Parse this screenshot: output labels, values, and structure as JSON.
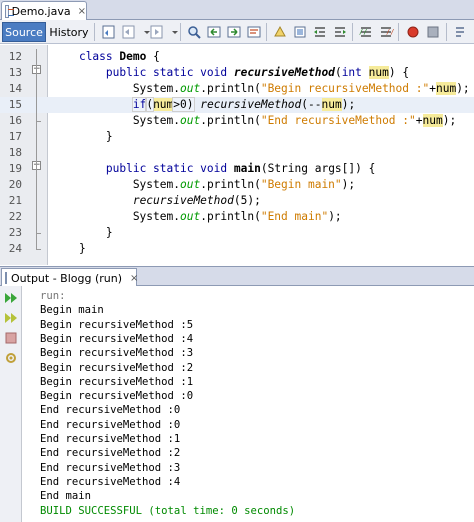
{
  "editor_tab": {
    "filename": "Demo.java",
    "close_glyph": "×"
  },
  "toolbar": {
    "source_label": "Source",
    "history_label": "History",
    "icons": [
      "last-edit-icon",
      "back-icon",
      "forward-icon",
      "find-icon",
      "find-previous-icon",
      "find-next-icon",
      "find-selection-icon",
      "toggle-highlight-icon",
      "toggle-rectangular-icon",
      "shift-left-icon",
      "shift-right-icon",
      "comment-icon",
      "uncomment-icon",
      "start-macro-icon",
      "stop-macro-icon"
    ]
  },
  "code_lines": [
    {
      "num": "12",
      "tokens": [
        [
          "",
          "    "
        ],
        [
          "kw",
          "class"
        ],
        [
          "",
          " "
        ],
        [
          "bold",
          "Demo"
        ],
        [
          "",
          " {"
        ]
      ]
    },
    {
      "num": "13",
      "tokens": [
        [
          "",
          "        "
        ],
        [
          "kw",
          "public static void"
        ],
        [
          "",
          " "
        ],
        [
          "mth bold",
          "recursiveMethod"
        ],
        [
          "",
          "("
        ],
        [
          "kw",
          "int"
        ],
        [
          "",
          " "
        ],
        [
          "var",
          "num"
        ],
        [
          "",
          ") {"
        ]
      ]
    },
    {
      "num": "14",
      "tokens": [
        [
          "",
          "            System."
        ],
        [
          "fld",
          "out"
        ],
        [
          "",
          ".println("
        ],
        [
          "str",
          "\"Begin recursiveMethod :\""
        ],
        [
          "",
          "+"
        ],
        [
          "var",
          "num"
        ],
        [
          "",
          ");"
        ]
      ]
    },
    {
      "num": "15",
      "tokens": [
        [
          "",
          "            "
        ],
        [
          "box kw",
          "if"
        ],
        [
          "box",
          "("
        ],
        [
          "var",
          "num"
        ],
        [
          "box",
          ">0)"
        ],
        [
          "",
          " "
        ],
        [
          "mth",
          "recursiveMethod"
        ],
        [
          "",
          "(--"
        ],
        [
          "var",
          "num"
        ],
        [
          "",
          ");"
        ]
      ]
    },
    {
      "num": "16",
      "tokens": [
        [
          "",
          "            System."
        ],
        [
          "fld",
          "out"
        ],
        [
          "",
          ".println("
        ],
        [
          "str",
          "\"End recursiveMethod :\""
        ],
        [
          "",
          "+"
        ],
        [
          "var",
          "num"
        ],
        [
          "",
          ");"
        ]
      ]
    },
    {
      "num": "17",
      "tokens": [
        [
          "",
          "        }"
        ]
      ]
    },
    {
      "num": "18",
      "tokens": []
    },
    {
      "num": "19",
      "tokens": [
        [
          "",
          "        "
        ],
        [
          "kw",
          "public static void"
        ],
        [
          "",
          " "
        ],
        [
          "bold",
          "main"
        ],
        [
          "",
          "(String args[]) {"
        ]
      ]
    },
    {
      "num": "20",
      "tokens": [
        [
          "",
          "            System."
        ],
        [
          "fld",
          "out"
        ],
        [
          "",
          ".println("
        ],
        [
          "str",
          "\"Begin main\""
        ],
        [
          "",
          ");"
        ]
      ]
    },
    {
      "num": "21",
      "tokens": [
        [
          "",
          "            "
        ],
        [
          "mth",
          "recursiveMethod"
        ],
        [
          "",
          "(5);"
        ]
      ]
    },
    {
      "num": "22",
      "tokens": [
        [
          "",
          "            System."
        ],
        [
          "fld",
          "out"
        ],
        [
          "",
          ".println("
        ],
        [
          "str",
          "\"End main\""
        ],
        [
          "",
          ");"
        ]
      ]
    },
    {
      "num": "23",
      "tokens": [
        [
          "",
          "        }"
        ]
      ]
    },
    {
      "num": "24",
      "tokens": [
        [
          "",
          "    }"
        ]
      ]
    }
  ],
  "output": {
    "tab_label": "Output - Blogg (run)",
    "close_glyph": "×",
    "lines": [
      {
        "text": "run:",
        "style": "dim"
      },
      {
        "text": "Begin main",
        "style": ""
      },
      {
        "text": "Begin recursiveMethod :5",
        "style": ""
      },
      {
        "text": "Begin recursiveMethod :4",
        "style": ""
      },
      {
        "text": "Begin recursiveMethod :3",
        "style": ""
      },
      {
        "text": "Begin recursiveMethod :2",
        "style": ""
      },
      {
        "text": "Begin recursiveMethod :1",
        "style": ""
      },
      {
        "text": "Begin recursiveMethod :0",
        "style": ""
      },
      {
        "text": "End recursiveMethod :0",
        "style": ""
      },
      {
        "text": "End recursiveMethod :0",
        "style": ""
      },
      {
        "text": "End recursiveMethod :1",
        "style": ""
      },
      {
        "text": "End recursiveMethod :2",
        "style": ""
      },
      {
        "text": "End recursiveMethod :3",
        "style": ""
      },
      {
        "text": "End recursiveMethod :4",
        "style": ""
      },
      {
        "text": "End main",
        "style": ""
      },
      {
        "text": "BUILD SUCCESSFUL (total time: 0 seconds)",
        "style": "ok"
      }
    ]
  },
  "colors": {
    "keyword": "#00009a",
    "string": "#ce7b00",
    "field": "#009a00",
    "var_highlight": "#f6eb9a",
    "success": "#008a00",
    "active_tab": "#4a7cc2"
  }
}
